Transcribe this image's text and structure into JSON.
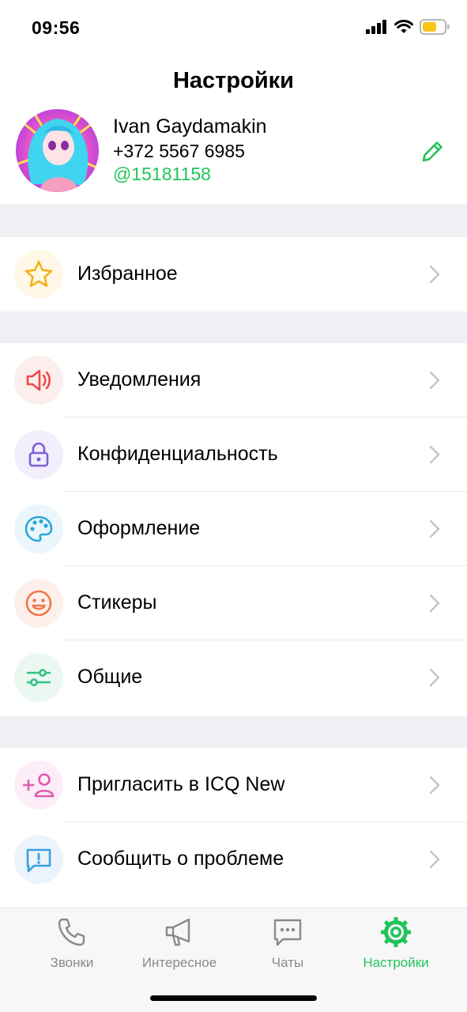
{
  "status": {
    "time": "09:56"
  },
  "header": {
    "title": "Настройки"
  },
  "profile": {
    "name": "Ivan Gaydamakin",
    "phone": "+372 5567 6985",
    "nickname": "@15181158"
  },
  "settings": {
    "favorites": {
      "label": "Избранное",
      "icon": "star-icon",
      "color": "#f2b21b"
    },
    "notifications": {
      "label": "Уведомления",
      "icon": "speaker-icon",
      "color": "#ec4a4a"
    },
    "privacy": {
      "label": "Конфиденциальность",
      "icon": "lock-icon",
      "color": "#7c5fd6"
    },
    "appearance": {
      "label": "Оформление",
      "icon": "palette-icon",
      "color": "#2aa8d8"
    },
    "stickers": {
      "label": "Стикеры",
      "icon": "smiley-icon",
      "color": "#f0764a"
    },
    "general": {
      "label": "Общие",
      "icon": "sliders-icon",
      "color": "#33c282"
    },
    "invite": {
      "label": "Пригласить в ICQ New",
      "icon": "add-user-icon",
      "color": "#e05ab0"
    },
    "report": {
      "label": "Сообщить о проблеме",
      "icon": "report-icon",
      "color": "#3b9fe0"
    }
  },
  "tabs": [
    {
      "label": "Звонки",
      "icon": "phone-icon"
    },
    {
      "label": "Интересное",
      "icon": "megaphone-icon"
    },
    {
      "label": "Чаты",
      "icon": "chat-icon"
    },
    {
      "label": "Настройки",
      "icon": "settings-gear-icon",
      "active": true
    }
  ],
  "colors": {
    "accent": "#22c45a",
    "background_gap": "#eff0f4"
  }
}
